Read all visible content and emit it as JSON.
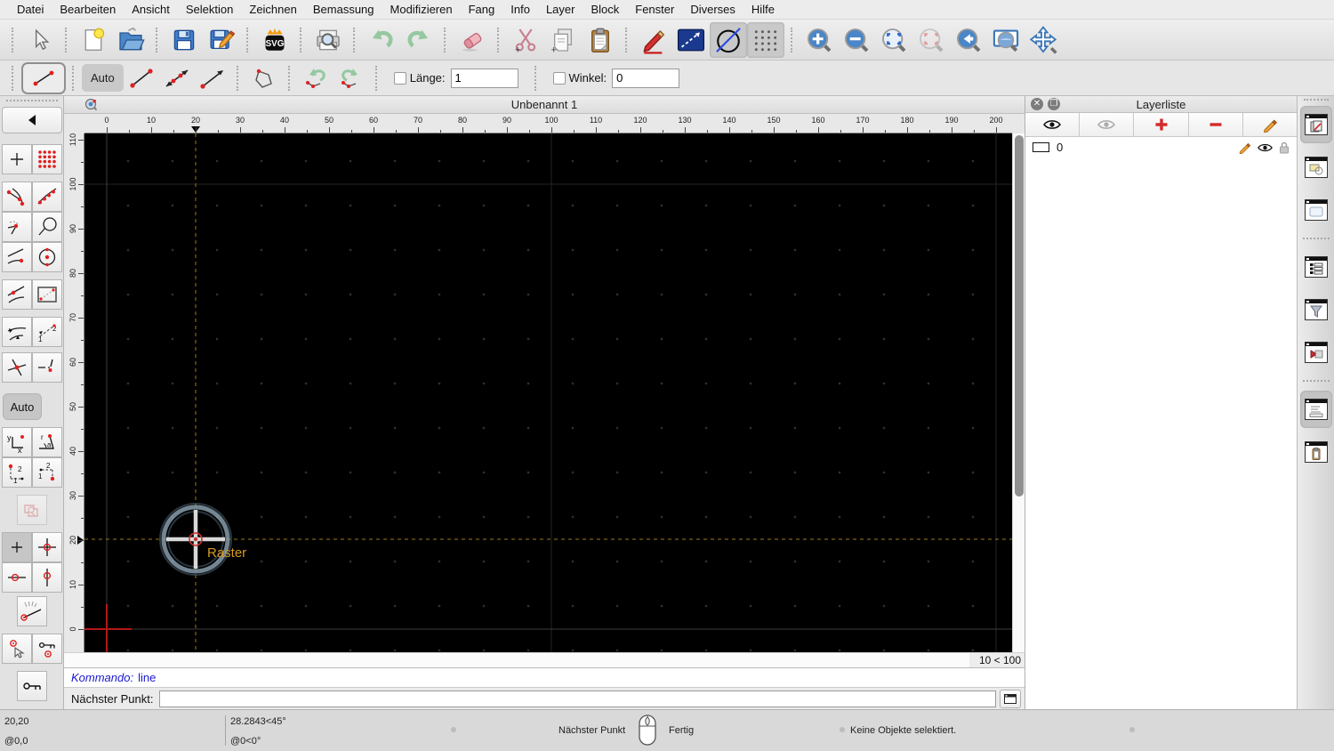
{
  "menu": {
    "items": [
      {
        "label": "Datei"
      },
      {
        "label": "Bearbeiten"
      },
      {
        "label": "Ansicht"
      },
      {
        "label": "Selektion"
      },
      {
        "label": "Zeichnen"
      },
      {
        "label": "Bemassung"
      },
      {
        "label": "Modifizieren"
      },
      {
        "label": "Fang"
      },
      {
        "label": "Info"
      },
      {
        "label": "Layer"
      },
      {
        "label": "Block"
      },
      {
        "label": "Fenster"
      },
      {
        "label": "Diverses"
      },
      {
        "label": "Hilfe"
      }
    ]
  },
  "main_toolbar": {
    "icons": [
      "pointer",
      "new-document",
      "open-folder",
      "save",
      "save-as",
      "svg-export",
      "print-preview",
      "undo",
      "redo",
      "eraser",
      "cut",
      "copy",
      "paste",
      "draw-pencil",
      "selection-rectangle",
      "draft-mode (pressed)",
      "grid-toggle (pressed)",
      "zoom-in",
      "zoom-out",
      "zoom-auto",
      "zoom-selection (disabled)",
      "zoom-previous",
      "zoom-window",
      "pan"
    ],
    "svg_badge": "SVG"
  },
  "options_toolbar": {
    "auto_label": "Auto",
    "icons": [
      "line-tool-current",
      "line-segment",
      "line-both-arrows",
      "line-arrow",
      "polyline",
      "undo-segment",
      "redo-segment"
    ],
    "laenge_label": "Länge:",
    "laenge_value": "1",
    "winkel_label": "Winkel:",
    "winkel_value": "0"
  },
  "snap_palette": {
    "auto_label": "Auto",
    "icons": [
      "collapse-back",
      "snap-free",
      "snap-grid",
      "snap-endpoints",
      "snap-on-entity",
      "snap-auto",
      "snap-perpendicular",
      "snap-tangent",
      "snap-center",
      "snap-nearest",
      "snap-reference",
      "restrict-angle",
      "restrict-steps",
      "snap-intersection",
      "snap-intersection-manual",
      "coordinates-cartesian",
      "coordinates-polar",
      "relative-coordinates",
      "absolute-coordinates",
      "restrict-off",
      "restrict-none",
      "restrict-orthogonal",
      "restrict-horizontal",
      "restrict-vertical",
      "angle-dial",
      "set-relative-zero",
      "lock-relative-zero",
      "relative-zero-key"
    ]
  },
  "document": {
    "title": "Unbenannt 1",
    "grid_info": "10 < 100",
    "raster_label": "Raster"
  },
  "rulers": {
    "horizontal": [
      "0",
      "10",
      "20",
      "30",
      "40",
      "50",
      "60",
      "70",
      "80",
      "90",
      "100",
      "110",
      "120",
      "130",
      "140",
      "150",
      "160",
      "170",
      "180",
      "190",
      "200"
    ],
    "vertical": [
      "0",
      "10",
      "20",
      "30",
      "40",
      "50",
      "60",
      "70",
      "80",
      "90",
      "100",
      "110"
    ],
    "cursor_marker_h": "20",
    "cursor_marker_v": "20"
  },
  "command_area": {
    "history_prefix": "Kommando:",
    "history_command": "line",
    "prompt_label": "Nächster Punkt:",
    "prompt_value": ""
  },
  "layer_panel": {
    "title": "Layerliste",
    "toolbar_icons": [
      "show-all-layers-eye",
      "hide-all-layers-eye",
      "add-layer-plus",
      "remove-layer-minus",
      "edit-layer-pencil"
    ],
    "layers": [
      {
        "name": "0",
        "row_icons": [
          "edit-pencil",
          "visible-eye",
          "lock"
        ]
      }
    ]
  },
  "right_dock": {
    "icons": [
      "layer-list-panel (pressed)",
      "block-list-panel",
      "view-list-panel",
      "property-editor-panel",
      "selection-filter-panel",
      "library-browser-panel",
      "command-line-panel (pressed)",
      "clipboard-panel"
    ]
  },
  "status_bar": {
    "abs_coord": "20,20",
    "rel_coord": "@0,0",
    "abs_polar": "28.2843<45°",
    "rel_polar": "@0<0°",
    "action_hint": "Nächster Punkt",
    "right_hint": "Fertig",
    "selection_info": "Keine Objekte selektiert."
  },
  "colors": {
    "canvas_bg": "#000000",
    "crosshair_orange": "#9c7a10",
    "raster_label_color": "#d79a25",
    "origin_red": "#b51616",
    "accent_red": "#d42a2a",
    "accent_blue": "#4a86c8"
  }
}
